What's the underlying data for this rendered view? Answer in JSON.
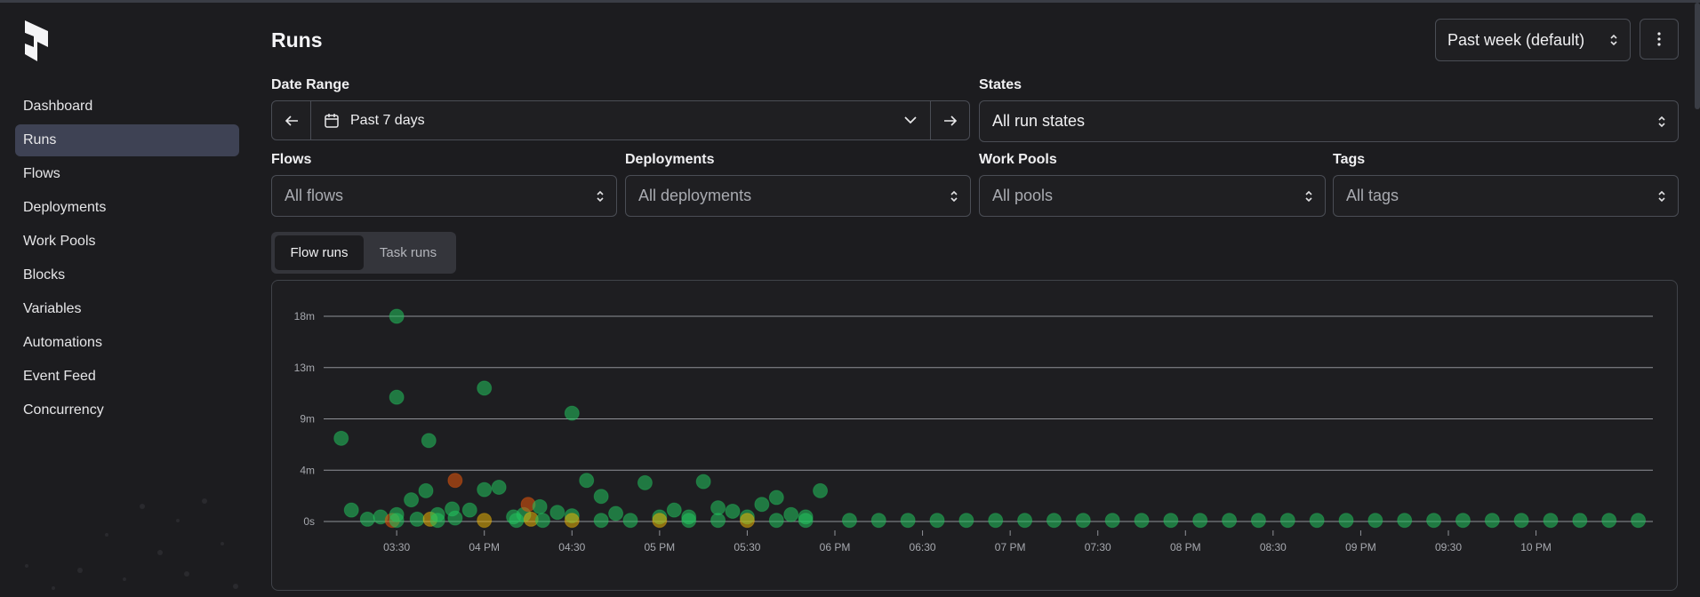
{
  "sidebar": {
    "items": [
      {
        "label": "Dashboard",
        "active": false
      },
      {
        "label": "Runs",
        "active": true
      },
      {
        "label": "Flows",
        "active": false
      },
      {
        "label": "Deployments",
        "active": false
      },
      {
        "label": "Work Pools",
        "active": false
      },
      {
        "label": "Blocks",
        "active": false
      },
      {
        "label": "Variables",
        "active": false
      },
      {
        "label": "Automations",
        "active": false
      },
      {
        "label": "Event Feed",
        "active": false
      },
      {
        "label": "Concurrency",
        "active": false
      }
    ]
  },
  "header": {
    "title": "Runs",
    "preset": "Past week (default)"
  },
  "filters": {
    "date_range_label": "Date Range",
    "date_range_value": "Past 7 days",
    "states_label": "States",
    "states_value": "All run states",
    "flows_label": "Flows",
    "flows_value": "All flows",
    "deployments_label": "Deployments",
    "deployments_value": "All deployments",
    "work_pools_label": "Work Pools",
    "work_pools_value": "All pools",
    "tags_label": "Tags",
    "tags_value": "All tags"
  },
  "tabs": {
    "flow_runs": "Flow runs",
    "task_runs": "Task runs"
  },
  "colors": {
    "completed": "#22c55e",
    "failed": "#ea580c",
    "pending": "#eab308",
    "active_nav": "#3e4254"
  },
  "chart_data": {
    "type": "scatter",
    "y_ticks": [
      "0s",
      "4m",
      "9m",
      "13m",
      "18m"
    ],
    "y_tick_values": [
      0,
      4.5,
      9,
      13.5,
      18
    ],
    "ylim": [
      0,
      18
    ],
    "x_ticks": [
      "03:30",
      "04 PM",
      "04:30",
      "05 PM",
      "05:30",
      "06 PM",
      "06:30",
      "07 PM",
      "07:30",
      "08 PM",
      "08:30",
      "09 PM",
      "09:30",
      "10 PM"
    ],
    "x_tick_values": [
      210,
      240,
      270,
      300,
      330,
      360,
      390,
      420,
      450,
      480,
      510,
      540,
      570,
      600
    ],
    "xlim": [
      185,
      640
    ],
    "points": [
      {
        "x": 191,
        "y": 7.3,
        "state": "completed"
      },
      {
        "x": 194.5,
        "y": 1.0,
        "state": "completed"
      },
      {
        "x": 200,
        "y": 0.2,
        "state": "completed"
      },
      {
        "x": 204.5,
        "y": 0.4,
        "state": "completed"
      },
      {
        "x": 208.5,
        "y": 0.1,
        "state": "failed"
      },
      {
        "x": 210,
        "y": 0.6,
        "state": "completed"
      },
      {
        "x": 210,
        "y": 10.9,
        "state": "completed"
      },
      {
        "x": 210,
        "y": 18.0,
        "state": "completed"
      },
      {
        "x": 210,
        "y": 0.1,
        "state": "completed"
      },
      {
        "x": 215,
        "y": 1.9,
        "state": "completed"
      },
      {
        "x": 217,
        "y": 0.2,
        "state": "completed"
      },
      {
        "x": 220,
        "y": 2.7,
        "state": "completed"
      },
      {
        "x": 221,
        "y": 7.1,
        "state": "completed"
      },
      {
        "x": 221.5,
        "y": 0.2,
        "state": "pending"
      },
      {
        "x": 224,
        "y": 0.6,
        "state": "completed"
      },
      {
        "x": 224,
        "y": 0.1,
        "state": "completed"
      },
      {
        "x": 229,
        "y": 1.1,
        "state": "completed"
      },
      {
        "x": 230,
        "y": 3.6,
        "state": "failed"
      },
      {
        "x": 230,
        "y": 0.3,
        "state": "completed"
      },
      {
        "x": 235,
        "y": 1.0,
        "state": "completed"
      },
      {
        "x": 240,
        "y": 11.7,
        "state": "completed"
      },
      {
        "x": 240,
        "y": 2.8,
        "state": "completed"
      },
      {
        "x": 240,
        "y": 0.1,
        "state": "pending"
      },
      {
        "x": 245,
        "y": 3.0,
        "state": "completed"
      },
      {
        "x": 250,
        "y": 0.4,
        "state": "completed"
      },
      {
        "x": 251,
        "y": 0.1,
        "state": "completed"
      },
      {
        "x": 253.5,
        "y": 0.6,
        "state": "completed"
      },
      {
        "x": 255,
        "y": 1.5,
        "state": "failed"
      },
      {
        "x": 256,
        "y": 0.2,
        "state": "pending"
      },
      {
        "x": 259,
        "y": 1.3,
        "state": "completed"
      },
      {
        "x": 260,
        "y": 0.1,
        "state": "completed"
      },
      {
        "x": 265,
        "y": 0.8,
        "state": "completed"
      },
      {
        "x": 270,
        "y": 9.5,
        "state": "completed"
      },
      {
        "x": 270,
        "y": 0.5,
        "state": "completed"
      },
      {
        "x": 270,
        "y": 0.1,
        "state": "pending"
      },
      {
        "x": 275,
        "y": 3.6,
        "state": "completed"
      },
      {
        "x": 280,
        "y": 2.2,
        "state": "completed"
      },
      {
        "x": 280,
        "y": 0.1,
        "state": "completed"
      },
      {
        "x": 285,
        "y": 0.7,
        "state": "completed"
      },
      {
        "x": 290,
        "y": 0.1,
        "state": "completed"
      },
      {
        "x": 295,
        "y": 3.4,
        "state": "completed"
      },
      {
        "x": 300,
        "y": 0.4,
        "state": "completed"
      },
      {
        "x": 300,
        "y": 0.1,
        "state": "pending"
      },
      {
        "x": 305,
        "y": 1.0,
        "state": "completed"
      },
      {
        "x": 310,
        "y": 0.4,
        "state": "completed"
      },
      {
        "x": 310,
        "y": 0.1,
        "state": "completed"
      },
      {
        "x": 315,
        "y": 3.5,
        "state": "completed"
      },
      {
        "x": 320,
        "y": 1.2,
        "state": "completed"
      },
      {
        "x": 320,
        "y": 0.1,
        "state": "completed"
      },
      {
        "x": 325,
        "y": 0.9,
        "state": "completed"
      },
      {
        "x": 330,
        "y": 0.4,
        "state": "completed"
      },
      {
        "x": 330,
        "y": 0.1,
        "state": "pending"
      },
      {
        "x": 335,
        "y": 1.5,
        "state": "completed"
      },
      {
        "x": 340,
        "y": 2.1,
        "state": "completed"
      },
      {
        "x": 340,
        "y": 0.1,
        "state": "completed"
      },
      {
        "x": 345,
        "y": 0.6,
        "state": "completed"
      },
      {
        "x": 350,
        "y": 0.4,
        "state": "completed"
      },
      {
        "x": 350,
        "y": 0.1,
        "state": "completed"
      },
      {
        "x": 355,
        "y": 2.7,
        "state": "completed"
      },
      {
        "x": 365,
        "y": 0.1,
        "state": "completed"
      },
      {
        "x": 375,
        "y": 0.1,
        "state": "completed"
      },
      {
        "x": 385,
        "y": 0.1,
        "state": "completed"
      },
      {
        "x": 395,
        "y": 0.1,
        "state": "completed"
      },
      {
        "x": 405,
        "y": 0.1,
        "state": "completed"
      },
      {
        "x": 415,
        "y": 0.1,
        "state": "completed"
      },
      {
        "x": 425,
        "y": 0.1,
        "state": "completed"
      },
      {
        "x": 435,
        "y": 0.1,
        "state": "completed"
      },
      {
        "x": 445,
        "y": 0.1,
        "state": "completed"
      },
      {
        "x": 455,
        "y": 0.1,
        "state": "completed"
      },
      {
        "x": 465,
        "y": 0.1,
        "state": "completed"
      },
      {
        "x": 475,
        "y": 0.1,
        "state": "completed"
      },
      {
        "x": 485,
        "y": 0.1,
        "state": "completed"
      },
      {
        "x": 495,
        "y": 0.1,
        "state": "completed"
      },
      {
        "x": 505,
        "y": 0.1,
        "state": "completed"
      },
      {
        "x": 515,
        "y": 0.1,
        "state": "completed"
      },
      {
        "x": 525,
        "y": 0.1,
        "state": "completed"
      },
      {
        "x": 535,
        "y": 0.1,
        "state": "completed"
      },
      {
        "x": 545,
        "y": 0.1,
        "state": "completed"
      },
      {
        "x": 555,
        "y": 0.1,
        "state": "completed"
      },
      {
        "x": 565,
        "y": 0.1,
        "state": "completed"
      },
      {
        "x": 575,
        "y": 0.1,
        "state": "completed"
      },
      {
        "x": 585,
        "y": 0.1,
        "state": "completed"
      },
      {
        "x": 595,
        "y": 0.1,
        "state": "completed"
      },
      {
        "x": 605,
        "y": 0.1,
        "state": "completed"
      },
      {
        "x": 615,
        "y": 0.1,
        "state": "completed"
      },
      {
        "x": 625,
        "y": 0.1,
        "state": "completed"
      },
      {
        "x": 635,
        "y": 0.1,
        "state": "completed"
      }
    ]
  }
}
